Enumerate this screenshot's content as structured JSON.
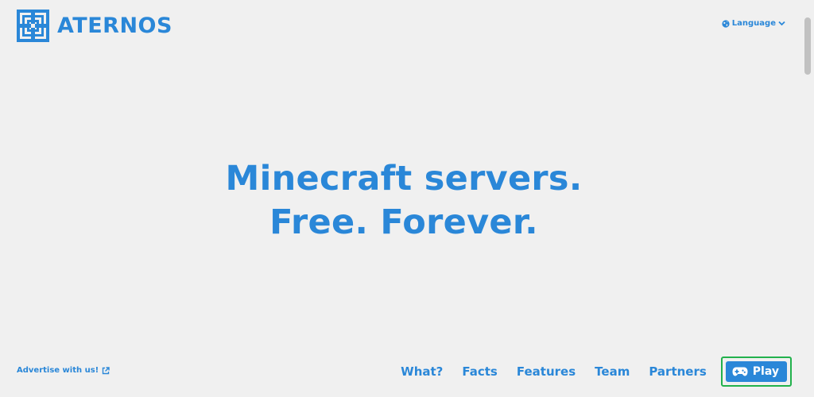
{
  "header": {
    "brand": "ATERNOS",
    "logo_icon": "aternos-logo-icon",
    "language_label": "Language",
    "language_icon": "globe-icon",
    "language_chevron_icon": "chevron-down-icon"
  },
  "hero": {
    "line1": "Minecraft servers.",
    "line2": "Free. Forever."
  },
  "footer": {
    "advertise_label": "Advertise with us!",
    "advertise_icon": "external-link-icon",
    "nav": [
      {
        "label": "What?"
      },
      {
        "label": "Facts"
      },
      {
        "label": "Features"
      },
      {
        "label": "Team"
      },
      {
        "label": "Partners"
      }
    ],
    "play_label": "Play",
    "play_icon": "gamepad-icon"
  },
  "colors": {
    "accent": "#2a87d8",
    "background": "#f0f0f0",
    "highlight": "#22b14c"
  }
}
